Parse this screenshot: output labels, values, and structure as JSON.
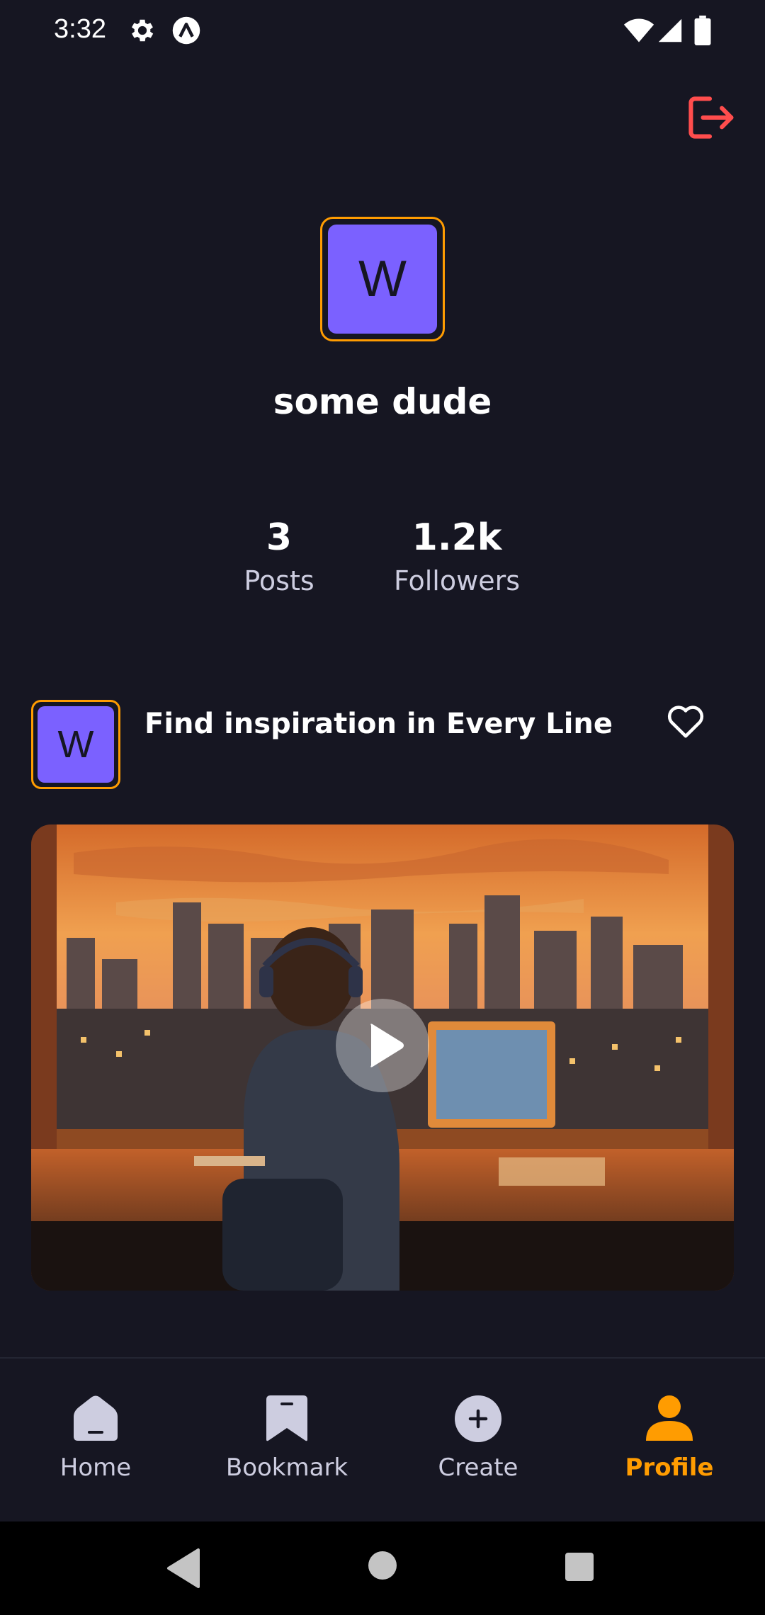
{
  "status_bar": {
    "time": "3:32",
    "icons": [
      "gear-icon",
      "app-logo-icon",
      "wifi-icon",
      "signal-icon",
      "battery-icon"
    ]
  },
  "header": {
    "logout_icon": "logout-icon"
  },
  "profile": {
    "avatar_letter": "W",
    "username": "some dude",
    "stats": {
      "posts_value": "3",
      "posts_label": "Posts",
      "followers_value": "1.2k",
      "followers_label": "Followers"
    }
  },
  "post": {
    "avatar_letter": "W",
    "title": "Find inspiration in Every Line",
    "like_icon": "heart-outline-icon",
    "thumbnail": "city-at-sunset-desk-illustration",
    "play_icon": "play-icon"
  },
  "tabs": [
    {
      "label": "Home",
      "icon": "home-icon",
      "active": false
    },
    {
      "label": "Bookmark",
      "icon": "bookmark-icon",
      "active": false
    },
    {
      "label": "Create",
      "icon": "plus-circle-icon",
      "active": false
    },
    {
      "label": "Profile",
      "icon": "profile-icon",
      "active": true
    }
  ],
  "colors": {
    "background": "#161622",
    "accent": "#FF9C01",
    "avatar": "#7B61FF",
    "logout": "#FF4D4D",
    "muted_text": "#CDCDE0"
  }
}
